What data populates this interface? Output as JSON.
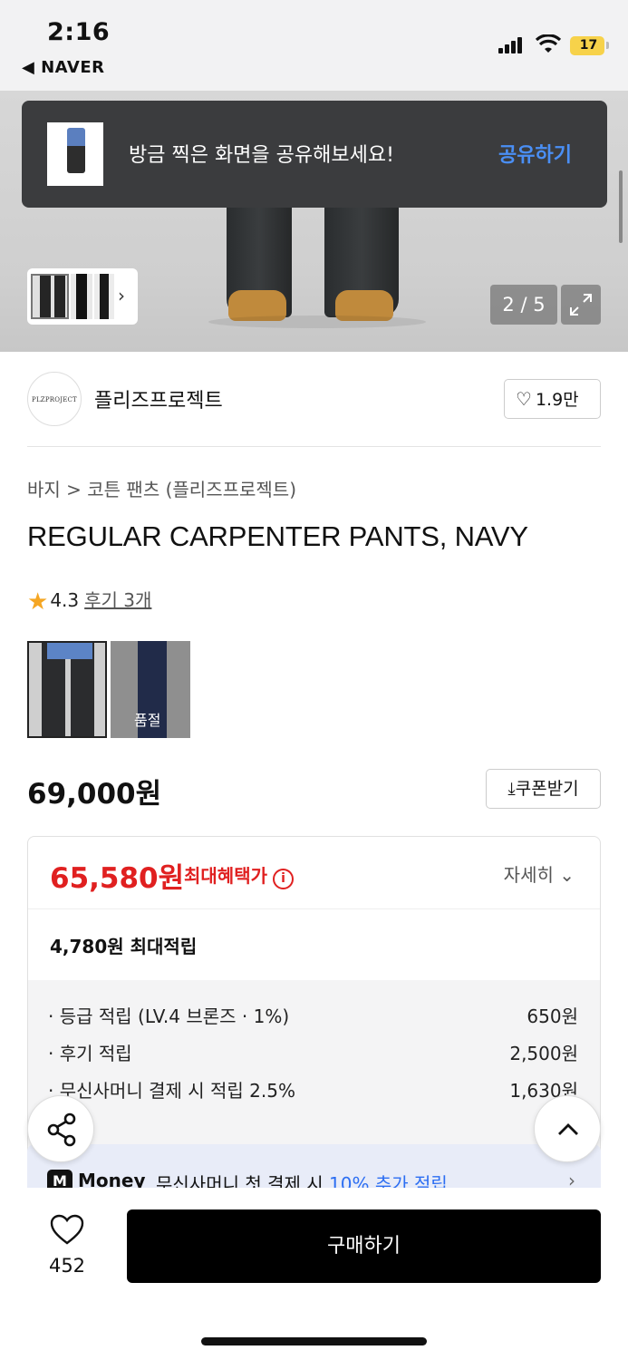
{
  "status": {
    "time": "2:16",
    "back_app": "◀ NAVER",
    "battery": "17"
  },
  "gallery": {
    "pager": "2 / 5"
  },
  "toast": {
    "message": "방금 찍은 화면을 공유해보세요!",
    "action": "공유하기"
  },
  "brand": {
    "logo_text": "PLZPROJECT",
    "name": "플리즈프로젝트",
    "like_count": "1.9만"
  },
  "breadcrumb": "바지 > 코튼 팬츠 (플리즈프로젝트)",
  "product": {
    "title": "REGULAR CARPENTER PANTS, NAVY",
    "rating": "4.3",
    "reviews": "후기 3개",
    "sold_out_label": "품절",
    "price": "69,000원",
    "coupon_label": "쿠폰받기"
  },
  "benefit": {
    "sale_price": "65,580원",
    "max_benefit_label": "최대혜택가",
    "detail_label": "자세히",
    "points_total": "4,780원 최대적립",
    "rows": [
      {
        "label": "· 등급 적립 (LV.4 브론즈 · 1%)",
        "value": "650원"
      },
      {
        "label": "· 후기 적립",
        "value": "2,500원"
      },
      {
        "label": "· 무신사머니 결제 시 적립 2.5%",
        "value": "1,630원"
      }
    ]
  },
  "money_banner": {
    "logo": "M",
    "brand": "Money",
    "text_prefix": "무신사머니 첫 결제 시 ",
    "highlight": "10% 추가 적립"
  },
  "bottom": {
    "wish_count": "452",
    "buy_label": "구매하기"
  },
  "colors": {
    "sale_red": "#e02020",
    "accent_blue": "#4a8ff5",
    "highlight_blue": "#2c6ef2",
    "battery": "#f7d24a"
  }
}
